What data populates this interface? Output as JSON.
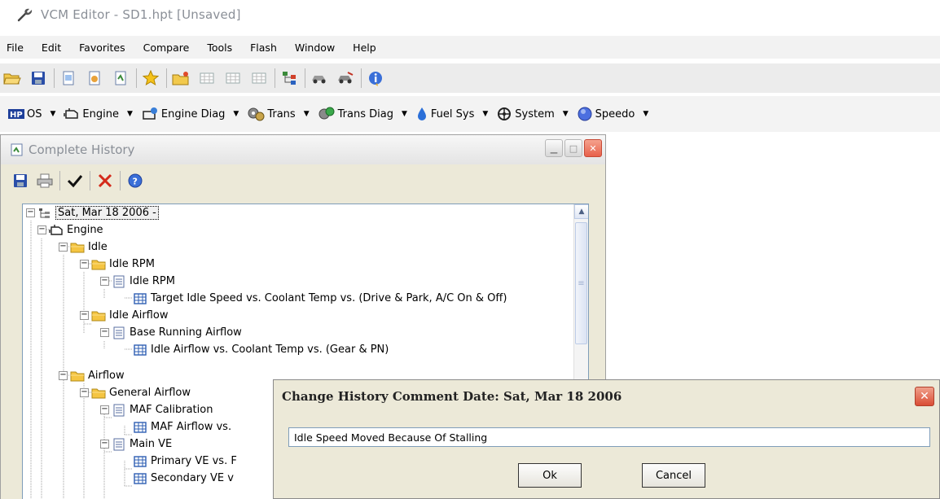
{
  "app": {
    "title": "VCM Editor - SD1.hpt   [Unsaved]"
  },
  "menu": [
    "File",
    "Edit",
    "Favorites",
    "Compare",
    "Tools",
    "Flash",
    "Window",
    "Help"
  ],
  "categories": [
    {
      "label": "OS",
      "icon": "hp-os-icon"
    },
    {
      "label": "Engine",
      "icon": "engine-icon"
    },
    {
      "label": "Engine Diag",
      "icon": "engine-diag-icon"
    },
    {
      "label": "Trans",
      "icon": "gears-icon"
    },
    {
      "label": "Trans Diag",
      "icon": "trans-diag-icon"
    },
    {
      "label": "Fuel Sys",
      "icon": "fuel-drop-icon"
    },
    {
      "label": "System",
      "icon": "system-wheel-icon"
    },
    {
      "label": "Speedo",
      "icon": "speedo-icon"
    }
  ],
  "history_window": {
    "title": "Complete History",
    "tree": [
      {
        "label": "Sat, Mar 18 2006 -",
        "icon": "history-icon"
      },
      {
        "label": "Engine",
        "icon": "engine-icon"
      },
      {
        "label": "Idle",
        "icon": "folder-icon"
      },
      {
        "label": "Idle RPM",
        "icon": "folder-icon"
      },
      {
        "label": "Idle RPM",
        "icon": "document-icon"
      },
      {
        "label": "Target Idle Speed vs. Coolant Temp vs. (Drive & Park, A/C On & Off)",
        "icon": "table-icon"
      },
      {
        "label": "Idle Airflow",
        "icon": "folder-icon"
      },
      {
        "label": "Base Running Airflow",
        "icon": "document-icon"
      },
      {
        "label": "Idle Airflow vs. Coolant Temp vs. (Gear & PN)",
        "icon": "table-icon"
      },
      {
        "label": "Airflow",
        "icon": "folder-icon"
      },
      {
        "label": "General Airflow",
        "icon": "folder-icon"
      },
      {
        "label": "MAF Calibration",
        "icon": "document-icon"
      },
      {
        "label": "MAF Airflow vs.",
        "icon": "table-icon"
      },
      {
        "label": "Main VE",
        "icon": "document-icon"
      },
      {
        "label": "Primary VE vs. F",
        "icon": "table-icon"
      },
      {
        "label": "Secondary VE v",
        "icon": "table-icon"
      }
    ]
  },
  "dialog": {
    "title": "Change History Comment  Date: Sat, Mar 18 2006",
    "comment_value": "Idle Speed Moved Because Of Stalling",
    "ok_label": "Ok",
    "cancel_label": "Cancel"
  },
  "colors": {
    "titlebar_text": "#8a8f97",
    "window_bg": "#ece9d8",
    "close_red": "#d94d35",
    "folder_yellow": "#f5c542",
    "table_blue": "#2f5fb3"
  }
}
